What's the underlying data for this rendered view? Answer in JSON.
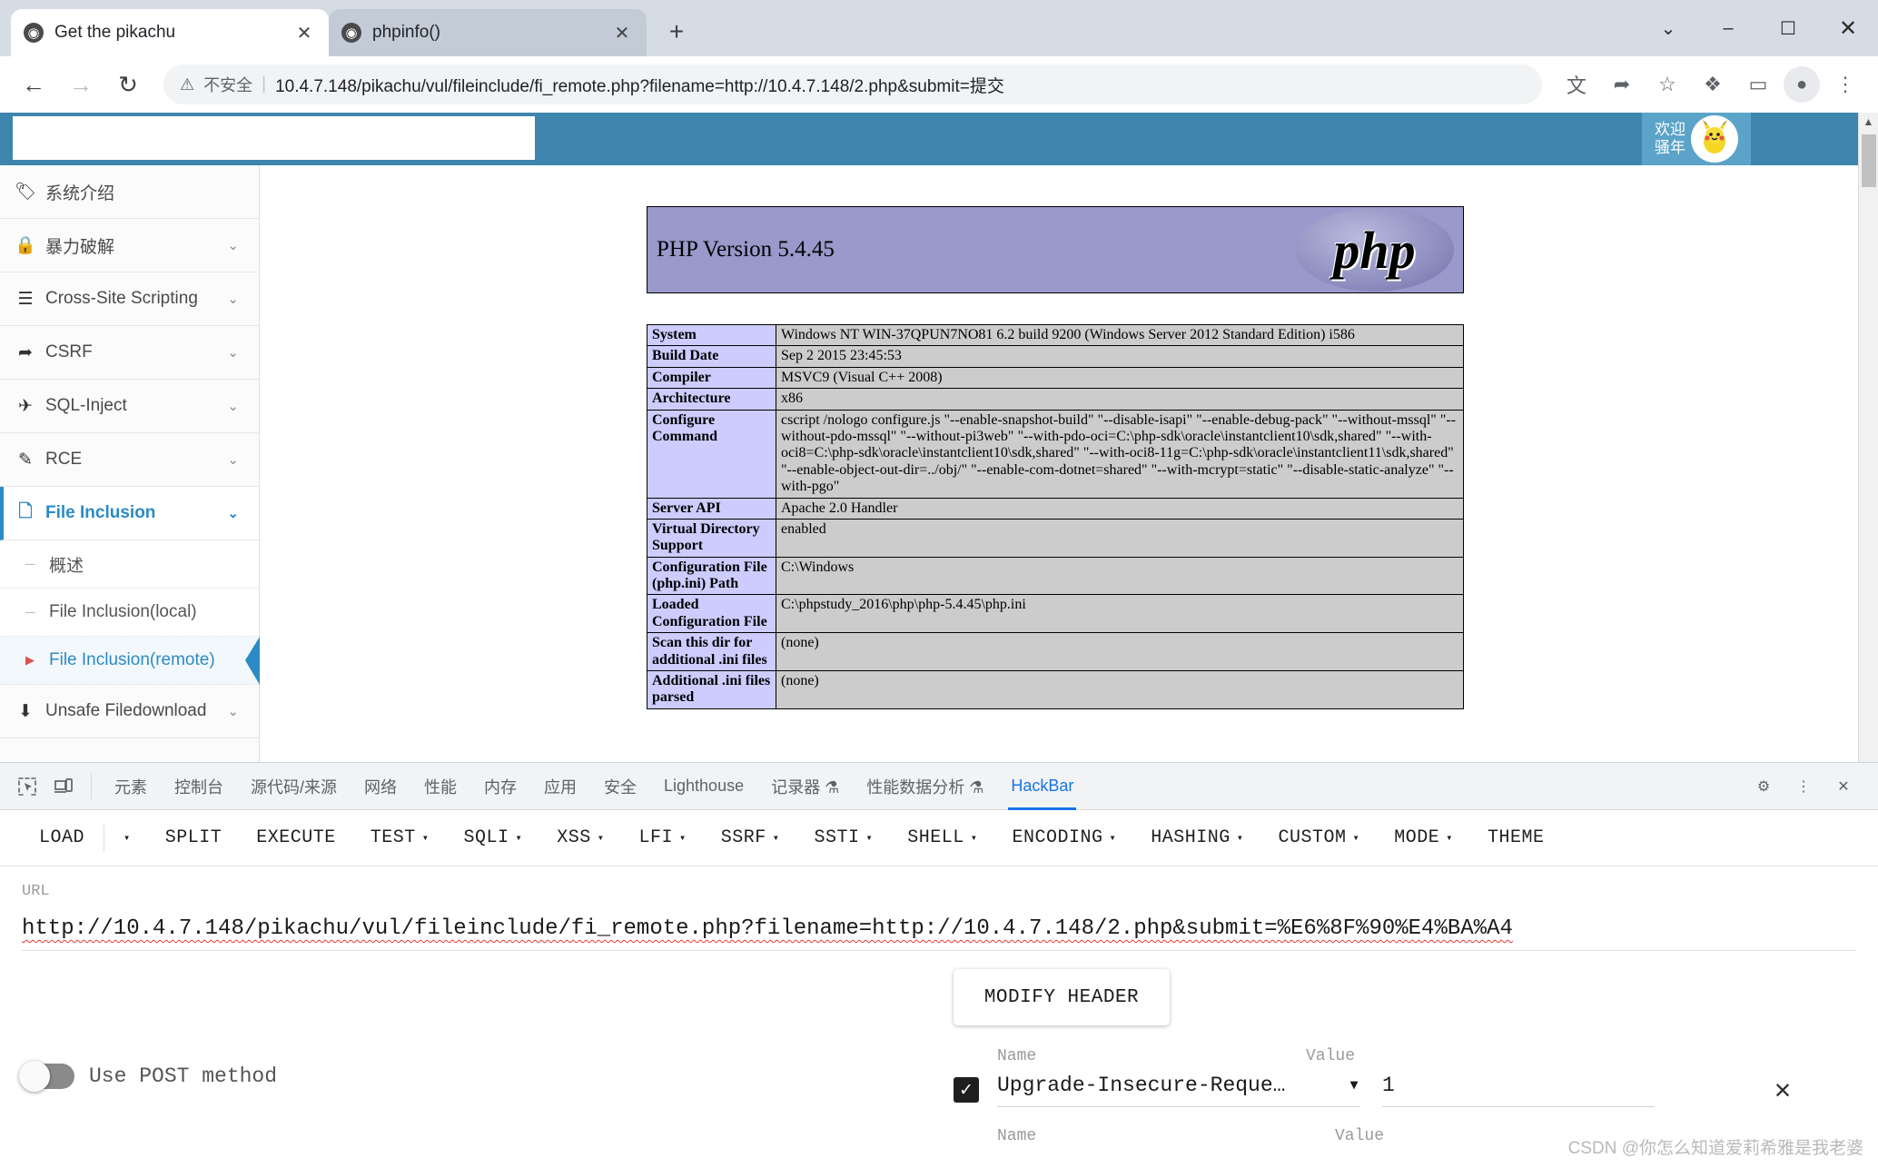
{
  "browser": {
    "tabs": [
      {
        "title": "Get the pikachu",
        "favicon": "globe-icon",
        "active": true,
        "close_label": "✕"
      },
      {
        "title": "phpinfo()",
        "favicon": "globe-icon",
        "active": false,
        "close_label": "✕"
      }
    ],
    "new_tab_label": "+",
    "window_controls": {
      "minimize": "–",
      "maximize": "☐",
      "close": "✕",
      "tabsearch": "⌄"
    },
    "nav": {
      "back": "←",
      "forward": "→",
      "reload": "↻"
    },
    "omnibox": {
      "warning_icon": "⚠",
      "security_label": "不安全",
      "divider": "|",
      "url": "10.4.7.148/pikachu/vul/fileinclude/fi_remote.php?filename=http://10.4.7.148/2.php&submit=提交"
    },
    "toolbar_icons": [
      {
        "name": "translate-icon",
        "glyph": "文"
      },
      {
        "name": "share-icon",
        "glyph": "➦"
      },
      {
        "name": "bookmark-star-icon",
        "glyph": "☆"
      },
      {
        "name": "extensions-puzzle-icon",
        "glyph": "❖"
      },
      {
        "name": "side-panel-icon",
        "glyph": "▭"
      },
      {
        "name": "profile-avatar-icon",
        "glyph": "●"
      },
      {
        "name": "chrome-menu-icon",
        "glyph": "⋮"
      }
    ]
  },
  "site": {
    "header": {
      "welcome_line1": "欢迎",
      "welcome_line2": "骚年",
      "avatar_icon": "pikachu-avatar"
    },
    "sidebar": {
      "items": [
        {
          "label": "系统介绍",
          "icon": "🏷",
          "caret": "",
          "active": false
        },
        {
          "label": "暴力破解",
          "icon": "🔒",
          "caret": "⌄",
          "active": false
        },
        {
          "label": "Cross-Site Scripting",
          "icon": "☰",
          "caret": "⌄",
          "active": false
        },
        {
          "label": "CSRF",
          "icon": "➦",
          "caret": "⌄",
          "active": false
        },
        {
          "label": "SQL-Inject",
          "icon": "✈",
          "caret": "⌄",
          "active": false
        },
        {
          "label": "RCE",
          "icon": "✎",
          "caret": "⌄",
          "active": false
        },
        {
          "label": "File Inclusion",
          "icon": "🗋",
          "caret": "⌄",
          "active": true
        }
      ],
      "sub_items": [
        {
          "label": "概述",
          "selected": false
        },
        {
          "label": "File Inclusion(local)",
          "selected": false
        },
        {
          "label": "File Inclusion(remote)",
          "selected": true
        }
      ],
      "tail_items": [
        {
          "label": "Unsafe Filedownload",
          "icon": "⬇",
          "caret": "⌄",
          "active": false
        }
      ]
    }
  },
  "phpinfo": {
    "version_title": "PHP Version 5.4.45",
    "logo_text": "php",
    "rows": [
      {
        "key": "System",
        "value": "Windows NT WIN-37QPUN7NO81 6.2 build 9200 (Windows Server 2012 Standard Edition) i586"
      },
      {
        "key": "Build Date",
        "value": "Sep 2 2015 23:45:53"
      },
      {
        "key": "Compiler",
        "value": "MSVC9 (Visual C++ 2008)"
      },
      {
        "key": "Architecture",
        "value": "x86"
      },
      {
        "key": "Configure Command",
        "value": "cscript /nologo configure.js \"--enable-snapshot-build\" \"--disable-isapi\" \"--enable-debug-pack\" \"--without-mssql\" \"--without-pdo-mssql\" \"--without-pi3web\" \"--with-pdo-oci=C:\\php-sdk\\oracle\\instantclient10\\sdk,shared\" \"--with-oci8=C:\\php-sdk\\oracle\\instantclient10\\sdk,shared\" \"--with-oci8-11g=C:\\php-sdk\\oracle\\instantclient11\\sdk,shared\" \"--enable-object-out-dir=../obj/\" \"--enable-com-dotnet=shared\" \"--with-mcrypt=static\" \"--disable-static-analyze\" \"--with-pgo\""
      },
      {
        "key": "Server API",
        "value": "Apache 2.0 Handler"
      },
      {
        "key": "Virtual Directory Support",
        "value": "enabled"
      },
      {
        "key": "Configuration File (php.ini) Path",
        "value": "C:\\Windows"
      },
      {
        "key": "Loaded Configuration File",
        "value": "C:\\phpstudy_2016\\php\\php-5.4.45\\php.ini"
      },
      {
        "key": "Scan this dir for additional .ini files",
        "value": "(none)"
      },
      {
        "key": "Additional .ini files parsed",
        "value": "(none)"
      }
    ]
  },
  "devtools": {
    "left_icons": [
      {
        "name": "inspect-element-icon",
        "glyph": "↖"
      },
      {
        "name": "device-toolbar-icon",
        "glyph": "□"
      }
    ],
    "tabs": [
      {
        "label": "元素",
        "active": false
      },
      {
        "label": "控制台",
        "active": false
      },
      {
        "label": "源代码/来源",
        "active": false
      },
      {
        "label": "网络",
        "active": false
      },
      {
        "label": "性能",
        "active": false
      },
      {
        "label": "内存",
        "active": false
      },
      {
        "label": "应用",
        "active": false
      },
      {
        "label": "安全",
        "active": false
      },
      {
        "label": "Lighthouse",
        "active": false
      },
      {
        "label": "记录器 ⚗",
        "active": false
      },
      {
        "label": "性能数据分析 ⚗",
        "active": false
      },
      {
        "label": "HackBar",
        "active": true
      }
    ],
    "right_icons": [
      {
        "name": "settings-gear-icon",
        "glyph": "⚙"
      },
      {
        "name": "devtools-more-icon",
        "glyph": "⋮"
      },
      {
        "name": "devtools-close-icon",
        "glyph": "✕"
      }
    ]
  },
  "hackbar": {
    "menu": [
      {
        "label": "LOAD",
        "caret": ""
      },
      {
        "label": "",
        "caret": "▾",
        "separator_before": true
      },
      {
        "label": "SPLIT",
        "caret": ""
      },
      {
        "label": "EXECUTE",
        "caret": ""
      },
      {
        "label": "TEST",
        "caret": "▾"
      },
      {
        "label": "SQLI",
        "caret": "▾"
      },
      {
        "label": "XSS",
        "caret": "▾"
      },
      {
        "label": "LFI",
        "caret": "▾"
      },
      {
        "label": "SSRF",
        "caret": "▾"
      },
      {
        "label": "SSTI",
        "caret": "▾"
      },
      {
        "label": "SHELL",
        "caret": "▾"
      },
      {
        "label": "ENCODING",
        "caret": "▾"
      },
      {
        "label": "HASHING",
        "caret": "▾"
      },
      {
        "label": "CUSTOM",
        "caret": "▾"
      },
      {
        "label": "MODE",
        "caret": "▾"
      },
      {
        "label": "THEME",
        "caret": ""
      }
    ],
    "url_label": "URL",
    "url_value": "http://10.4.7.148/pikachu/vul/fileinclude/fi_remote.php?filename=http://10.4.7.148/2.php&submit=%E6%8F%90%E4%BA%A4",
    "post_toggle_label": "Use POST method",
    "post_toggle_on": false,
    "modify_header_label": "MODIFY HEADER",
    "header_table": {
      "name_label": "Name",
      "value_label": "Value",
      "rows": [
        {
          "checked": true,
          "check_glyph": "✓",
          "name": "Upgrade-Insecure-Reque…",
          "name_caret": "▾",
          "value": "1",
          "remove_glyph": "✕"
        }
      ],
      "empty_name_label": "Name",
      "empty_value_label": "Value"
    },
    "watermark": "CSDN @你怎么知道爱莉希雅是我老婆"
  }
}
